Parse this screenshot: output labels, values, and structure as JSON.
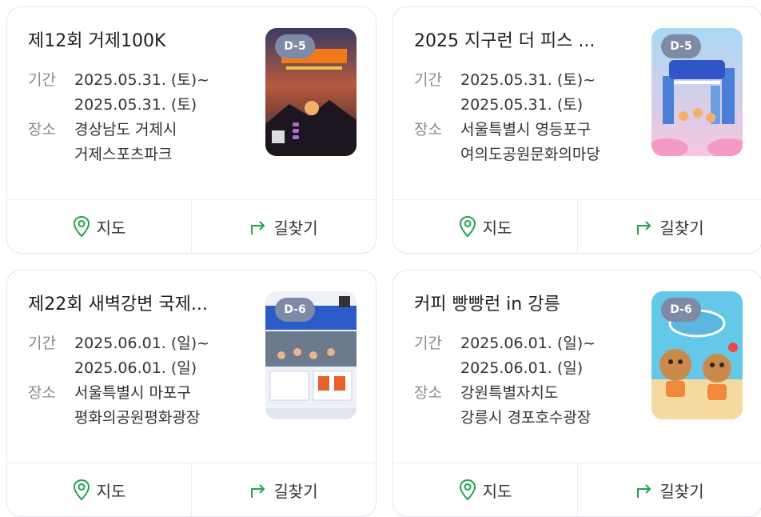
{
  "events": [
    {
      "title": "제12회 거제100K",
      "period_label": "기간",
      "period_start": "2025.05.31. (토)~",
      "period_end": "2025.05.31. (토)",
      "place_label": "장소",
      "place_line1": "경상남도 거제시",
      "place_line2": "거제스포츠파크",
      "dday": "D-5",
      "poster_icon": "race-poster-image",
      "map_label": "지도",
      "route_label": "길찾기"
    },
    {
      "title": "2025 지구런 더 피스 ...",
      "period_label": "기간",
      "period_start": "2025.05.31. (토)~",
      "period_end": "2025.05.31. (토)",
      "place_label": "장소",
      "place_line1": "서울특별시 영등포구",
      "place_line2": "여의도공원문화의마당",
      "dday": "D-5",
      "poster_icon": "race-poster-image",
      "map_label": "지도",
      "route_label": "길찾기"
    },
    {
      "title": "제22회 새벽강변 국제...",
      "period_label": "기간",
      "period_start": "2025.06.01. (일)~",
      "period_end": "2025.06.01. (일)",
      "place_label": "장소",
      "place_line1": "서울특별시 마포구",
      "place_line2": "평화의공원평화광장",
      "dday": "D-6",
      "poster_icon": "race-poster-image",
      "map_label": "지도",
      "route_label": "길찾기"
    },
    {
      "title": "커피 빵빵런 in 강릉",
      "period_label": "기간",
      "period_start": "2025.06.01. (일)~",
      "period_end": "2025.06.01. (일)",
      "place_label": "장소",
      "place_line1": "강원특별자치도",
      "place_line2": "강릉시 경포호수광장",
      "dday": "D-6",
      "poster_icon": "race-poster-image",
      "map_label": "지도",
      "route_label": "길찾기"
    }
  ],
  "colors": {
    "accent_green": "#1ea34f",
    "dday_badge": "#7e8aa6"
  }
}
